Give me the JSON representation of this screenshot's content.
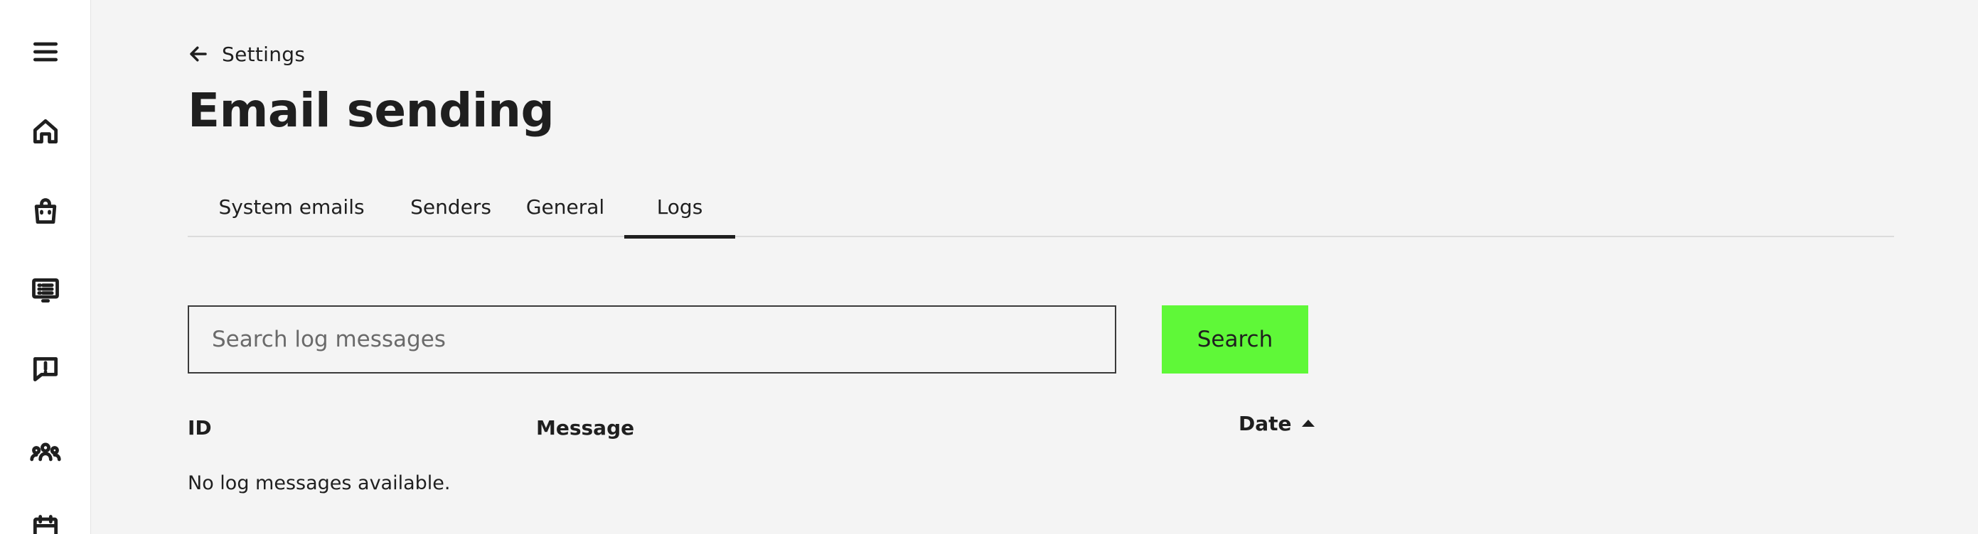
{
  "sidebar": {
    "items": [
      {
        "icon": "menu-icon"
      },
      {
        "icon": "home-icon"
      },
      {
        "icon": "shopping-bag-icon"
      },
      {
        "icon": "list-screen-icon"
      },
      {
        "icon": "alert-message-icon"
      },
      {
        "icon": "users-group-icon"
      },
      {
        "icon": "calendar-icon"
      }
    ]
  },
  "breadcrumb": {
    "label": "Settings",
    "icon": "arrow-left-icon"
  },
  "page": {
    "title": "Email sending"
  },
  "tabs": [
    {
      "label": "System emails",
      "active": false
    },
    {
      "label": "Senders",
      "active": false
    },
    {
      "label": "General",
      "active": false
    },
    {
      "label": "Logs",
      "active": true
    }
  ],
  "search": {
    "placeholder": "Search log messages",
    "value": "",
    "button_label": "Search"
  },
  "table": {
    "columns": [
      {
        "label": "ID"
      },
      {
        "label": "Message"
      },
      {
        "label": "Date",
        "sort": "ascending"
      }
    ],
    "empty_message": "No log messages available."
  },
  "colors": {
    "accent": "#5ff838",
    "background": "#f4f4f4",
    "text": "#1f1f1f"
  }
}
